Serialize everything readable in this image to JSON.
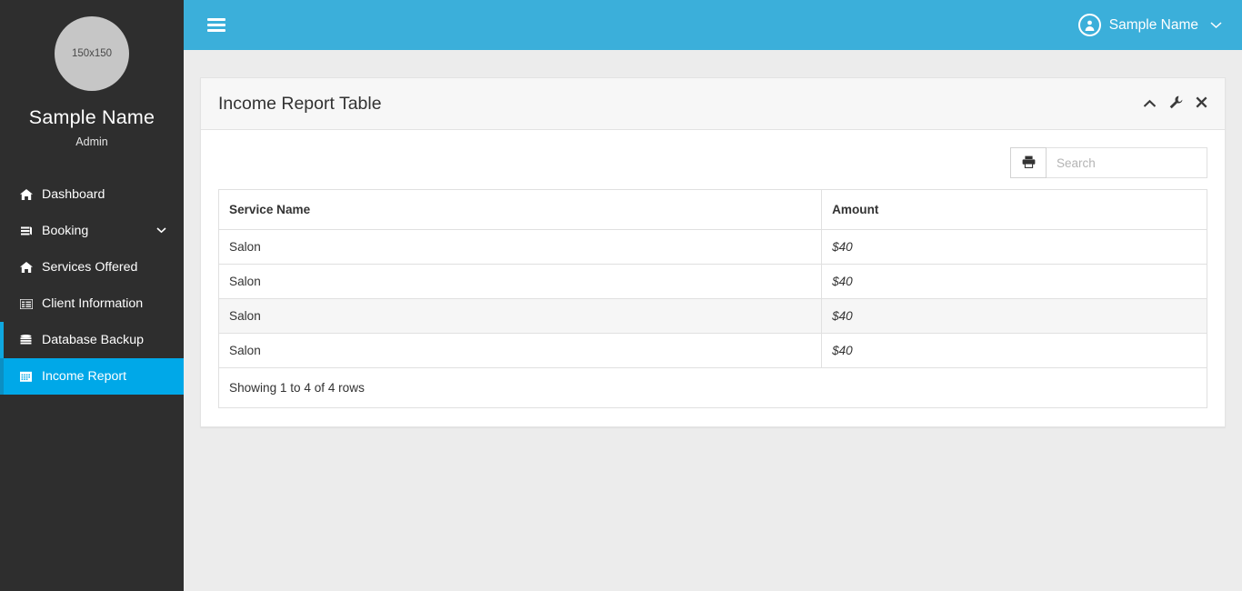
{
  "sidebar": {
    "avatar_label": "150x150",
    "profile_name": "Sample Name",
    "profile_role": "Admin",
    "items": [
      {
        "label": "Dashboard",
        "icon": "home-icon",
        "icon_glyph": "⌂",
        "state": "normal",
        "caret": ""
      },
      {
        "label": "Booking",
        "icon": "book-icon",
        "icon_glyph": "☰",
        "state": "normal",
        "caret": "⌄"
      },
      {
        "label": "Services Offered",
        "icon": "home-icon",
        "icon_glyph": "⌂",
        "state": "normal",
        "caret": ""
      },
      {
        "label": "Client Information",
        "icon": "list-icon",
        "icon_glyph": "▤",
        "state": "normal",
        "caret": ""
      },
      {
        "label": "Database Backup",
        "icon": "database-icon",
        "icon_glyph": "≣",
        "state": "accent",
        "caret": ""
      },
      {
        "label": "Income Report",
        "icon": "calendar-icon",
        "icon_glyph": "▦",
        "state": "active",
        "caret": ""
      }
    ]
  },
  "topbar": {
    "menu_toggle": "hamburger-icon",
    "user_name": "Sample Name",
    "user_caret": "⌄"
  },
  "panel": {
    "title": "Income Report Table",
    "tools": [
      {
        "name": "collapse",
        "glyph": "▲"
      },
      {
        "name": "config",
        "glyph": "⚒"
      },
      {
        "name": "close",
        "glyph": "✖"
      }
    ]
  },
  "toolbar": {
    "print_glyph": "⎙",
    "search_placeholder": "Search",
    "search_value": ""
  },
  "table": {
    "columns": [
      "Service Name",
      "Amount"
    ],
    "rows": [
      {
        "service": "Salon",
        "amount": "$40"
      },
      {
        "service": "Salon",
        "amount": "$40"
      },
      {
        "service": "Salon",
        "amount": "$40"
      },
      {
        "service": "Salon",
        "amount": "$40"
      }
    ],
    "footer": "Showing 1 to 4 of 4 rows"
  },
  "colors": {
    "header_blue": "#3BAFDA",
    "active_blue": "#00A8E8",
    "sidebar_dark": "#2E2E2E",
    "page_bg": "#ECECEC"
  }
}
